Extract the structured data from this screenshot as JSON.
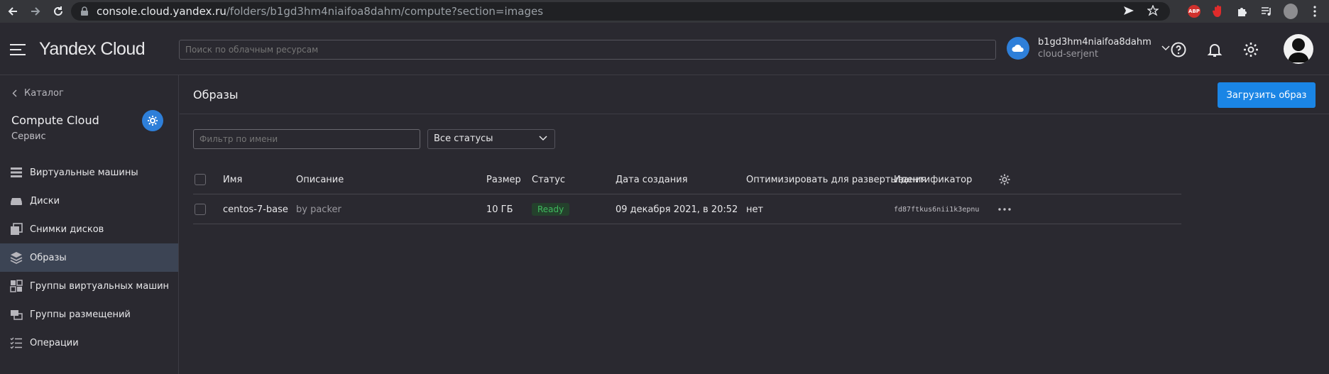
{
  "browser": {
    "url_host": "console.cloud.yandex.ru",
    "url_path": "/folders/b1gd3hm4niaifoa8dahm/compute?section=images",
    "abp_label": "ABP"
  },
  "header": {
    "logo_main": "Yandex",
    "logo_sub": "Cloud",
    "search_placeholder": "Поиск по облачным ресурсам",
    "cloud_id": "b1gd3hm4niaifoa8dahm",
    "cloud_name": "cloud-serjent"
  },
  "sidebar": {
    "back_label": "Каталог",
    "service_title": "Compute Cloud",
    "service_subtitle": "Сервис",
    "items": [
      {
        "label": "Виртуальные машины",
        "icon": "servers-icon"
      },
      {
        "label": "Диски",
        "icon": "disk-icon"
      },
      {
        "label": "Снимки дисков",
        "icon": "snapshots-icon"
      },
      {
        "label": "Образы",
        "icon": "layers-icon",
        "active": true
      },
      {
        "label": "Группы виртуальных машин",
        "icon": "vm-groups-icon"
      },
      {
        "label": "Группы размещений",
        "icon": "placement-groups-icon"
      },
      {
        "label": "Операции",
        "icon": "operations-icon"
      }
    ]
  },
  "main": {
    "title": "Образы",
    "upload_button": "Загрузить образ",
    "filter_placeholder": "Фильтр по имени",
    "status_filter": "Все статусы",
    "columns": [
      "Имя",
      "Описание",
      "Размер",
      "Статус",
      "Дата создания",
      "Оптимизировать для развертывания",
      "Идентификатор"
    ],
    "rows": [
      {
        "name": "centos-7-base",
        "description": "by packer",
        "size": "10 ГБ",
        "status": "Ready",
        "created": "09 декабря 2021, в 20:52",
        "optimize": "нет",
        "id": "fd87ftkus6nii1k3epnu"
      }
    ]
  },
  "colors": {
    "accent": "#1a85e5",
    "status_ready": "#3fb95e",
    "active_nav": "#3c4454"
  }
}
